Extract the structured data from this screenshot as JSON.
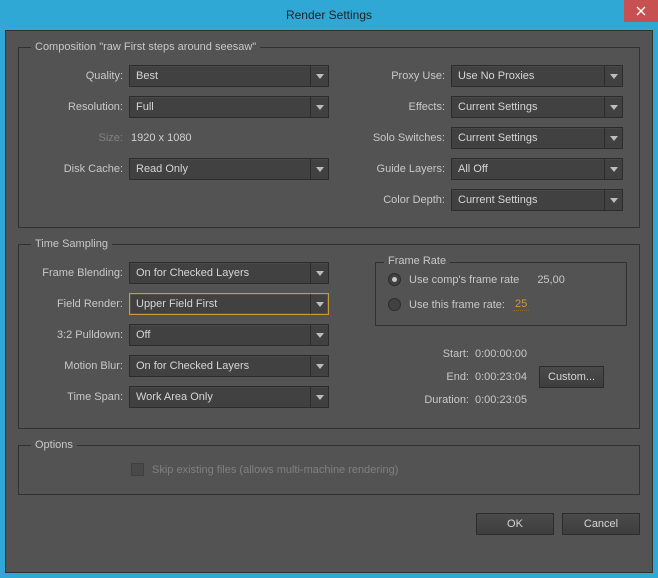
{
  "window": {
    "title": "Render Settings"
  },
  "composition": {
    "legend": "Composition \"raw First steps around seesaw\"",
    "left": {
      "quality": {
        "label": "Quality:",
        "value": "Best"
      },
      "resolution": {
        "label": "Resolution:",
        "value": "Full"
      },
      "size": {
        "label": "Size:",
        "value": "1920 x 1080"
      },
      "diskCache": {
        "label": "Disk Cache:",
        "value": "Read Only"
      }
    },
    "right": {
      "proxyUse": {
        "label": "Proxy Use:",
        "value": "Use No Proxies"
      },
      "effects": {
        "label": "Effects:",
        "value": "Current Settings"
      },
      "soloSwitches": {
        "label": "Solo Switches:",
        "value": "Current Settings"
      },
      "guideLayers": {
        "label": "Guide Layers:",
        "value": "All Off"
      },
      "colorDepth": {
        "label": "Color Depth:",
        "value": "Current Settings"
      }
    }
  },
  "timeSampling": {
    "legend": "Time Sampling",
    "frameBlending": {
      "label": "Frame Blending:",
      "value": "On for Checked Layers"
    },
    "fieldRender": {
      "label": "Field Render:",
      "value": "Upper Field First"
    },
    "pulldown": {
      "label": "3:2 Pulldown:",
      "value": "Off"
    },
    "motionBlur": {
      "label": "Motion Blur:",
      "value": "On for Checked Layers"
    },
    "timeSpan": {
      "label": "Time Span:",
      "value": "Work Area Only"
    },
    "frameRate": {
      "legend": "Frame Rate",
      "useComp": "Use comp's frame rate",
      "compRate": "25,00",
      "useThis": "Use this frame rate:",
      "thisRate": "25"
    },
    "info": {
      "start": {
        "label": "Start:",
        "value": "0:00:00:00"
      },
      "end": {
        "label": "End:",
        "value": "0:00:23:04"
      },
      "duration": {
        "label": "Duration:",
        "value": "0:00:23:05"
      },
      "custom": "Custom..."
    }
  },
  "options": {
    "legend": "Options",
    "skipExisting": "Skip existing files (allows multi-machine rendering)"
  },
  "footer": {
    "ok": "OK",
    "cancel": "Cancel"
  }
}
